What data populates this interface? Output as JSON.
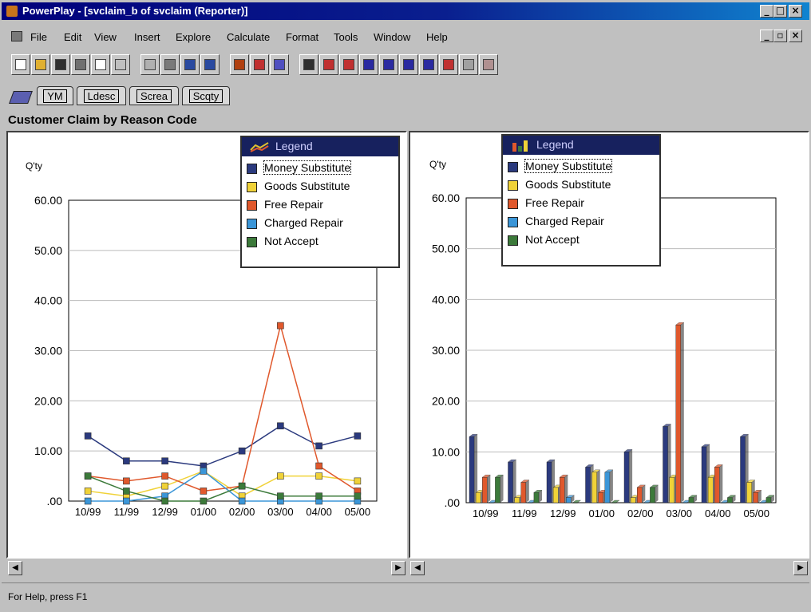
{
  "window": {
    "title": "PowerPlay - [svclaim_b of svclaim (Reporter)]",
    "controls": [
      "_",
      "□",
      "×"
    ],
    "doc_controls": [
      "_",
      "▫",
      "×"
    ]
  },
  "menu": [
    "File",
    "Edit",
    "View",
    "Insert",
    "Explore",
    "Calculate",
    "Format",
    "Tools",
    "Window",
    "Help"
  ],
  "toolbar": {
    "buttons": [
      "new-icon",
      "open-icon",
      "save-icon",
      "print-icon",
      "print-preview-icon",
      "undo-icon",
      "drill-down-icon",
      "drill-up-icon",
      "add-icon",
      "properties-icon",
      "sort-icon",
      "filter-icon",
      "swap-icon",
      "crosstab-icon",
      "pie-chart-icon",
      "3d-bar-icon",
      "simple-bar-icon",
      "clustered-bar-icon",
      "stacked-bar-icon",
      "line-chart-icon",
      "multiline-icon",
      "scatter-icon",
      "correlation-icon"
    ]
  },
  "dimension_tabs": [
    "YM",
    "Ldesc",
    "Screa",
    "Scqty"
  ],
  "report_title": "Customer Claim by Reason Code",
  "colors": {
    "Money Substitute": "#2b3a7e",
    "Goods Substitute": "#f0d238",
    "Free Repair": "#e0582c",
    "Charged Repair": "#3b96d8",
    "Not Accept": "#3c7a3a"
  },
  "legend": {
    "title": "Legend",
    "items": [
      "Money Substitute",
      "Goods Substitute",
      "Free Repair",
      "Charged Repair",
      "Not Accept"
    ]
  },
  "chart_data": [
    {
      "type": "line",
      "ylabel": "Q'ty",
      "ylim": [
        0,
        60
      ],
      "yticks": [
        "60.00",
        "50.00",
        "40.00",
        "30.00",
        "20.00",
        "10.00",
        ".00"
      ],
      "categories": [
        "10/99",
        "11/99",
        "12/99",
        "01/00",
        "02/00",
        "03/00",
        "04/00",
        "05/00"
      ],
      "grid": true,
      "legend": "top-right",
      "series": [
        {
          "name": "Money Substitute",
          "values": [
            13,
            8,
            8,
            7,
            10,
            15,
            11,
            13
          ]
        },
        {
          "name": "Goods Substitute",
          "values": [
            2,
            1,
            3,
            6,
            1,
            5,
            5,
            4
          ]
        },
        {
          "name": "Free Repair",
          "values": [
            5,
            4,
            5,
            2,
            3,
            35,
            7,
            2
          ]
        },
        {
          "name": "Charged Repair",
          "values": [
            0,
            0,
            1,
            6,
            0,
            0,
            0,
            0
          ]
        },
        {
          "name": "Not Accept",
          "values": [
            5,
            2,
            0,
            0,
            3,
            1,
            1,
            1
          ]
        }
      ]
    },
    {
      "type": "bar",
      "ylabel": "Q'ty",
      "ylim": [
        0,
        60
      ],
      "yticks": [
        "60.00",
        "50.00",
        "40.00",
        "30.00",
        "20.00",
        "10.00",
        ".00"
      ],
      "categories": [
        "10/99",
        "11/99",
        "12/99",
        "01/00",
        "02/00",
        "03/00",
        "04/00",
        "05/00"
      ],
      "grid": true,
      "legend": "top-right",
      "series": [
        {
          "name": "Money Substitute",
          "values": [
            13,
            8,
            8,
            7,
            10,
            15,
            11,
            13
          ]
        },
        {
          "name": "Goods Substitute",
          "values": [
            2,
            1,
            3,
            6,
            1,
            5,
            5,
            4
          ]
        },
        {
          "name": "Free Repair",
          "values": [
            5,
            4,
            5,
            2,
            3,
            35,
            7,
            2
          ]
        },
        {
          "name": "Charged Repair",
          "values": [
            0,
            0,
            1,
            6,
            0,
            0,
            0,
            0
          ]
        },
        {
          "name": "Not Accept",
          "values": [
            5,
            2,
            0,
            0,
            3,
            1,
            1,
            1
          ]
        }
      ]
    }
  ],
  "status_text": "For Help, press F1"
}
